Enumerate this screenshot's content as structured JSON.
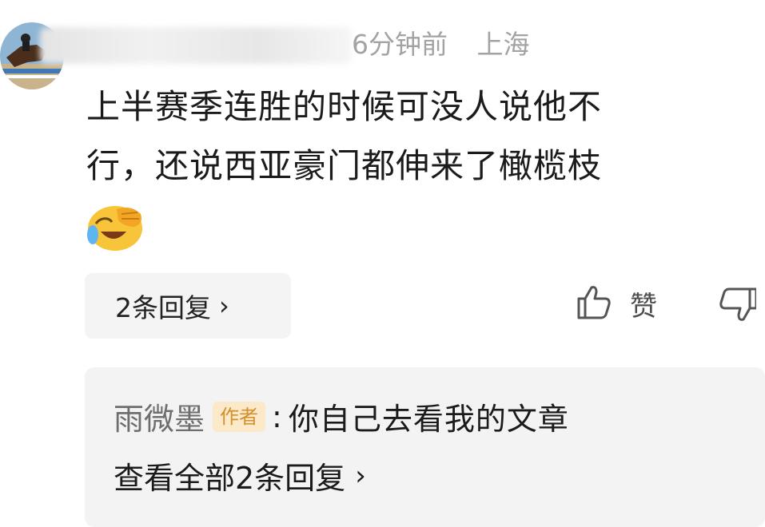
{
  "comment": {
    "meta_time": "6分钟前",
    "meta_location": "上海",
    "text_line1": "上半赛季连胜的时候可没人说他不",
    "text_line2": "行，还说西亚豪门都伸来了橄榄枝",
    "emoji": "facepalm-laughing-emoji"
  },
  "actions": {
    "replies_label": "2条回复",
    "like_label": "赞"
  },
  "reply": {
    "author": "雨微墨",
    "author_badge": "作者",
    "colon": ":",
    "text": "你自己去看我的文章",
    "view_all_label": "查看全部2条回复"
  },
  "colors": {
    "meta_gray": "#a3a3a3",
    "badge_bg": "#fbe9c9",
    "badge_text": "#d3902b",
    "reply_bg": "#f3f3f3"
  }
}
